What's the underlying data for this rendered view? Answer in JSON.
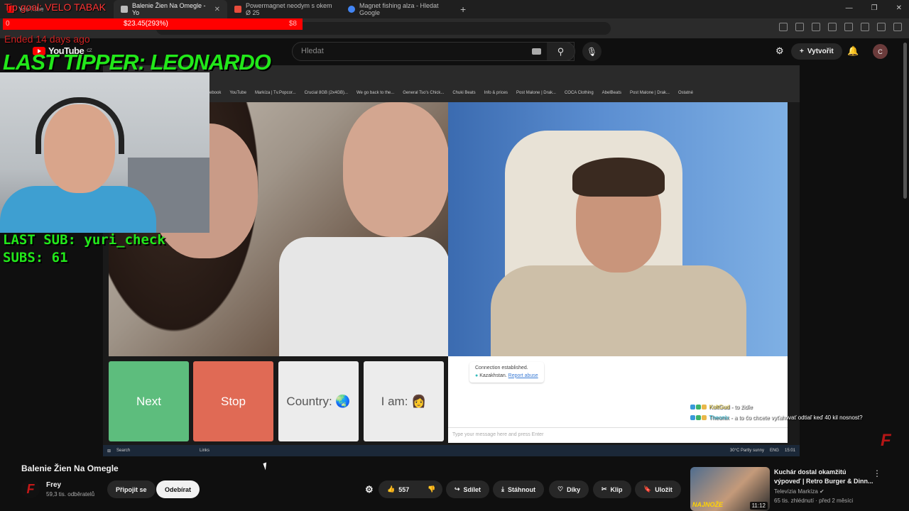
{
  "browser": {
    "tabs": [
      {
        "label": "YouTube",
        "active": false,
        "color": "#ff0000"
      },
      {
        "label": "Balenie Žien Na Omegle - Yo",
        "active": true,
        "color": "#bbbbbb"
      },
      {
        "label": "Powermagnet neodym s okem Ø 25",
        "active": false,
        "color": "#e74c3c"
      },
      {
        "label": "Magnet fishing alza - Hledat Google",
        "active": false,
        "color": "#4285f4"
      }
    ],
    "new_tab": "+"
  },
  "youtube": {
    "logo": "YouTube",
    "region": "CZ",
    "search_placeholder": "Hledat",
    "create_label": "Vytvořit",
    "avatar_letter": "C"
  },
  "overlay": {
    "tip_goal": "Tip goal: VELO TABAK",
    "goal_left": "0",
    "goal_center": "$23.45(293%)",
    "goal_right": "$8",
    "ended": "Ended 14 days ago",
    "last_tipper": "LAST TIPPER: LEONARDO",
    "last_sub": "LAST SUB: yuri_check",
    "subs": "SUBS: 61",
    "chat": [
      {
        "user": "KoltGud",
        "text": " - to židle"
      },
      {
        "user": "Theonix",
        "text": " - a to čo chcete vyťahovať odtiaľ keď 40 kil nosnost?"
      }
    ]
  },
  "stream": {
    "bookmarks": [
      "ebook",
      "YouTube",
      "Markíza | Tv.Popcor...",
      "Crucial 8GB (2x4GB)...",
      "We go back to the...",
      "General Tso's Chick...",
      "Chuki Beats",
      "Info & prices",
      "Post Malone | Drak...",
      "COCA Clothing",
      "AbelBeats",
      "Post Malone | Drak..."
    ],
    "bookmarks_other": "Ostatné",
    "next": "Next",
    "stop": "Stop",
    "country": "Country:",
    "iam": "I am:",
    "connection": "Connection established.",
    "country_name": "Kazakhstan.",
    "report": "Report abuse",
    "chat_placeholder": "Type your message here and press Enter",
    "taskbar_search": "Search",
    "taskbar_links": "Links",
    "weather": "30°C  Partly sunny",
    "lang": "ENG",
    "time": "15:01"
  },
  "video": {
    "title": "Balenie Žien Na Omegle",
    "channel": "Frey",
    "subscribers": "59,3 tis. odběratelů",
    "join": "Připojit se",
    "subscribe": "Odebírat",
    "likes": "557",
    "share": "Sdílet",
    "download": "Stáhnout",
    "thanks": "Díky",
    "clip": "Klip",
    "save": "Uložit"
  },
  "recommendation": {
    "title": "Kuchár dostal okamžitú výpoveď | Retro Burger & Dinn...",
    "channel": "Televízia Markíza",
    "meta": "65 tis. zhlédnutí · před 2 měsíci",
    "duration": "11:12",
    "thumb_tag": "NAJNOŽE"
  }
}
